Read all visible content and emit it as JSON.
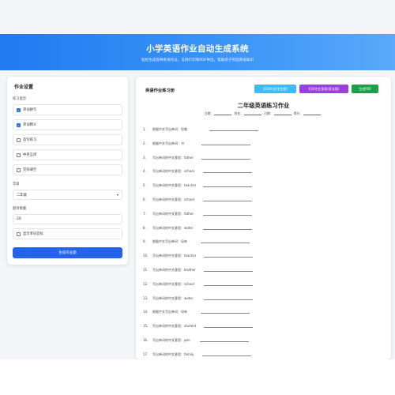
{
  "header": {
    "title": "小学英语作业自动生成系统",
    "subtitle": "轻松生成各种英语作业，支持打印和PDF导出，帮助孩子巩固英语知识"
  },
  "settings": {
    "title": "作业设置",
    "type_label": "练习类型",
    "options": [
      {
        "label": "单词拼写",
        "checked": true
      },
      {
        "label": "单词释义",
        "checked": true
      },
      {
        "label": "造句练习",
        "checked": false
      },
      {
        "label": "中英互译",
        "checked": false
      },
      {
        "label": "完形填空",
        "checked": false
      }
    ],
    "grade_label": "年级",
    "grade_value": "二年级",
    "count_label": "题目数量",
    "count_value": "20",
    "show_answers_label": "显示单词音标",
    "generate_button": "生成作业题"
  },
  "preview": {
    "title": "英语作业练习册",
    "print_student": "打印作业(学生版)",
    "print_teacher": "打印作业答案(家长版)",
    "export_pdf": "生成PDF",
    "doc_title": "二年级英语练习作业",
    "meta_date": "日期：",
    "meta_name": "姓名：",
    "meta_day": "日期：",
    "meta_score": "得分：",
    "questions": [
      {
        "num": "1.",
        "text": "根据中文写出单词：铅笔"
      },
      {
        "num": "2.",
        "text": "根据中文写出单词：书"
      },
      {
        "num": "3.",
        "text": "写出单词的中文意思：father"
      },
      {
        "num": "4.",
        "text": "写出单词的中文意思：school"
      },
      {
        "num": "5.",
        "text": "写出单词的中文意思：teacher"
      },
      {
        "num": "6.",
        "text": "写出单词的中文意思：school"
      },
      {
        "num": "7.",
        "text": "写出单词的中文意思：father"
      },
      {
        "num": "8.",
        "text": "写出单词的中文意思：water"
      },
      {
        "num": "9.",
        "text": "根据中文写出单词：母亲"
      },
      {
        "num": "10.",
        "text": "写出单词的中文意思：teacher"
      },
      {
        "num": "11.",
        "text": "写出单词的中文意思：brother"
      },
      {
        "num": "12.",
        "text": "写出单词的中文意思：school"
      },
      {
        "num": "13.",
        "text": "写出单词的中文意思：water"
      },
      {
        "num": "14.",
        "text": "根据中文写出单词：母亲"
      },
      {
        "num": "15.",
        "text": "写出单词的中文意思：student"
      },
      {
        "num": "16.",
        "text": "写出单词的中文意思：pen"
      },
      {
        "num": "17.",
        "text": "写出单词的中文意思：family"
      }
    ]
  },
  "colors": {
    "accent": "#2563eb",
    "btn_student": "#38bdf8",
    "btn_teacher": "#9b3fe0",
    "btn_pdf": "#16a34a"
  }
}
